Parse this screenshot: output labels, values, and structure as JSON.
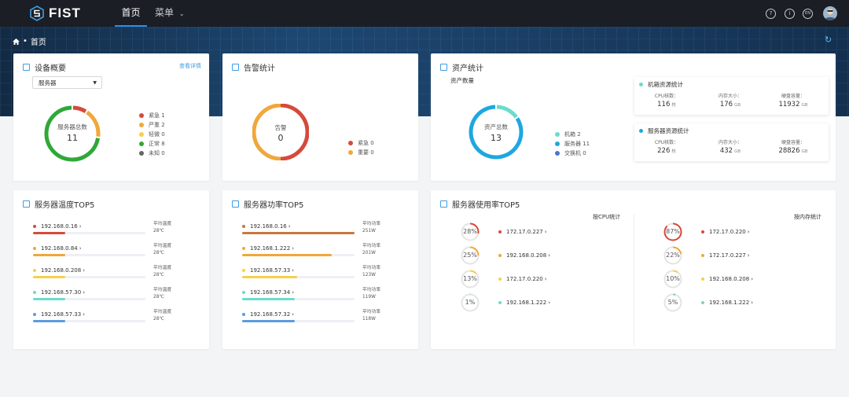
{
  "topbar": {
    "logo_text": "FIST",
    "nav": [
      {
        "label": "首页"
      },
      {
        "label": "菜单"
      }
    ],
    "icons": [
      "help-icon",
      "info-icon",
      "language-icon",
      "avatar"
    ],
    "lang_text": "EN"
  },
  "breadcrumb": {
    "home_icon": "home-icon",
    "separator": "•",
    "current": "首页"
  },
  "device_overview": {
    "title": "设备概要",
    "detail_link": "查看详情",
    "select_value": "服务器",
    "donut_label": "服务器总数",
    "donut_value": "11",
    "legend": [
      {
        "label": "紧急 1",
        "color": "#d64a3b",
        "count": 1
      },
      {
        "label": "严重 2",
        "color": "#f0a73b",
        "count": 2
      },
      {
        "label": "轻微 0",
        "color": "#f5d04a",
        "count": 0
      },
      {
        "label": "正常 8",
        "color": "#2fa838",
        "count": 8
      },
      {
        "label": "未知 0",
        "color": "#666666",
        "count": 0
      }
    ]
  },
  "alarm_stats": {
    "title": "告警统计",
    "donut_label": "告警",
    "donut_value": "0",
    "legend": [
      {
        "label": "紧急 0",
        "color": "#d64a3b"
      },
      {
        "label": "重要 0",
        "color": "#f0a73b"
      }
    ]
  },
  "asset_stats": {
    "title": "资产统计",
    "subtitle": "资产数量",
    "donut_label": "资产总数",
    "donut_value": "13",
    "legend": [
      {
        "label": "机箱 2",
        "color": "#6bdccd",
        "count": 2
      },
      {
        "label": "服务器 11",
        "color": "#1ea7e0",
        "count": 11
      },
      {
        "label": "交换机 0",
        "color": "#4a72d8",
        "count": 0
      }
    ],
    "chassis_box": {
      "title": "机箱资源统计",
      "dot_color": "#6bdccd",
      "items": [
        {
          "label": "CPU核数：",
          "value": "116",
          "unit": "核"
        },
        {
          "label": "内存大小：",
          "value": "176",
          "unit": "GB"
        },
        {
          "label": "硬盘容量：",
          "value": "11932",
          "unit": "GB"
        }
      ]
    },
    "server_box": {
      "title": "服务器资源统计",
      "dot_color": "#1ea7e0",
      "items": [
        {
          "label": "CPU核数：",
          "value": "226",
          "unit": "核"
        },
        {
          "label": "内存大小：",
          "value": "432",
          "unit": "GB"
        },
        {
          "label": "硬盘容量：",
          "value": "28826",
          "unit": "GB"
        }
      ]
    }
  },
  "temp_top5": {
    "title": "服务器温度TOP5",
    "rows": [
      {
        "ip": "192.168.0.16",
        "metric": "平均温度",
        "value": "28℃",
        "fraction": 0.29,
        "color": "#d64a3b"
      },
      {
        "ip": "192.168.0.84",
        "metric": "平均温度",
        "value": "28℃",
        "fraction": 0.29,
        "color": "#f0a73b"
      },
      {
        "ip": "192.168.0.208",
        "metric": "平均温度",
        "value": "28℃",
        "fraction": 0.29,
        "color": "#f5d04a"
      },
      {
        "ip": "192.168.57.30",
        "metric": "平均温度",
        "value": "28℃",
        "fraction": 0.29,
        "color": "#6bdccd"
      },
      {
        "ip": "192.168.57.33",
        "metric": "平均温度",
        "value": "28℃",
        "fraction": 0.29,
        "color": "#5b9be0"
      }
    ]
  },
  "power_top5": {
    "title": "服务器功率TOP5",
    "rows": [
      {
        "ip": "192.168.0.16",
        "metric": "平均功率",
        "value": "251W",
        "fraction": 1.0,
        "color": "#c9773f"
      },
      {
        "ip": "192.168.1.222",
        "metric": "平均功率",
        "value": "201W",
        "fraction": 0.8,
        "color": "#f0a73b"
      },
      {
        "ip": "192.168.57.33",
        "metric": "平均功率",
        "value": "123W",
        "fraction": 0.49,
        "color": "#f5d04a"
      },
      {
        "ip": "192.168.57.34",
        "metric": "平均功率",
        "value": "119W",
        "fraction": 0.47,
        "color": "#6bdccd"
      },
      {
        "ip": "192.168.57.32",
        "metric": "平均功率",
        "value": "118W",
        "fraction": 0.47,
        "color": "#5b9be0"
      }
    ]
  },
  "usage_top5": {
    "title": "服务器使用率TOP5",
    "cpu_header": "按CPU统计",
    "mem_header": "按内存统计",
    "cpu_rows": [
      {
        "ip": "172.17.0.227",
        "percent": "28%",
        "fraction": 0.28,
        "color": "#d64a3b"
      },
      {
        "ip": "192.168.0.208",
        "percent": "25%",
        "fraction": 0.25,
        "color": "#f0a73b"
      },
      {
        "ip": "172.17.0.220",
        "percent": "13%",
        "fraction": 0.13,
        "color": "#f5d04a"
      },
      {
        "ip": "192.168.1.222",
        "percent": "1%",
        "fraction": 0.01,
        "color": "#6bdccd"
      }
    ],
    "mem_rows": [
      {
        "ip": "172.17.0.220",
        "percent": "87%",
        "fraction": 0.87,
        "color": "#d64a3b"
      },
      {
        "ip": "172.17.0.227",
        "percent": "22%",
        "fraction": 0.22,
        "color": "#f0a73b"
      },
      {
        "ip": "192.168.0.208",
        "percent": "10%",
        "fraction": 0.1,
        "color": "#f5d04a"
      },
      {
        "ip": "192.168.1.222",
        "percent": "5%",
        "fraction": 0.05,
        "color": "#6bdccd"
      }
    ]
  }
}
